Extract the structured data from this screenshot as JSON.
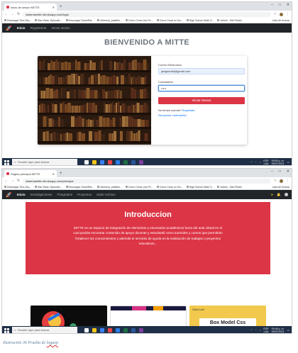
{
  "shot1": {
    "tab_title": "Inicio de sesion MITTE",
    "url": "sistemamitte.herokuapp.com/login",
    "bookmarks": [
      "Descargar Sim-City...",
      "Star Wars: Episodio...",
      "Descargar GameRai...",
      "Alchemy, plastilin...",
      "Cómo Crear una Pe...",
      "Cómo Crear un Bo...",
      "High School Math S...",
      "Admin - Mis Redes"
    ],
    "reading_list": "Lista de lectura",
    "nav": {
      "inicio": "Inicio",
      "registrarse": "Registrarse",
      "iniciar": "Iniciar sesion"
    },
    "heading": "BIENVENIDO A MITTE",
    "form": {
      "email_label": "Correo Electronico",
      "email_value": "jaclgarcia3@gmail.com",
      "password_label": "Contraseña",
      "password_value": "•••••",
      "submit_label": "Iniciar Sesion",
      "no_account_text": "No tienes cuenta?",
      "register_link": "Registrate",
      "recover_link": "Recuperar contraseña"
    },
    "taskbar": {
      "search_placeholder": "Escribe aquí para buscar",
      "lang": "ESP",
      "layout": "LAA",
      "time": "09:59 p. m.",
      "date": "05/07/2021"
    }
  },
  "shot2": {
    "tab_title": "Pagina principal MITTE",
    "url": "sistemamitte.herokuapp.com/principal",
    "bookmarks": [
      "Descargar Sim-City...",
      "Star Wars: Episodio...",
      "Descargar GameRai...",
      "Alchemy, plastilin...",
      "Cómo Crear una Pe...",
      "Cómo Crear un Bo...",
      "High School Math S...",
      "Admin - Mis Redes"
    ],
    "reading_list": "Lista de lectura",
    "nav": [
      "Inicio",
      "Investigaciones",
      "Posgrados",
      "Proyectos",
      "Subir Archivo"
    ],
    "intro_title": "Introduccion",
    "intro_text": "MITTE es un espacio de integración de elementos y escenarios académicos fuera del aula virtual en el cual podrás encontrar contenido de apoyo docente y estudiantil como tutoriales y cursos que permitirán fortalecer tus conocimientos y además te servirán de ayuda en la realización de trabajos o proyectos educativos...",
    "card3_label": "Box Model Css",
    "card3_tag": "StarCode",
    "taskbar": {
      "search_placeholder": "Escribe aquí para buscar",
      "lang": "ESP",
      "layout": "LAA",
      "time": "09:48 p. m.",
      "date": "05/07/2021"
    }
  },
  "caption": {
    "prefix": "Ilustración 36 Prueba de ",
    "underlined": "loguep"
  },
  "colors": {
    "accent": "#dc3545",
    "navbar": "#212529",
    "link": "#0d6efd",
    "taskbar": "#1f2f47"
  }
}
